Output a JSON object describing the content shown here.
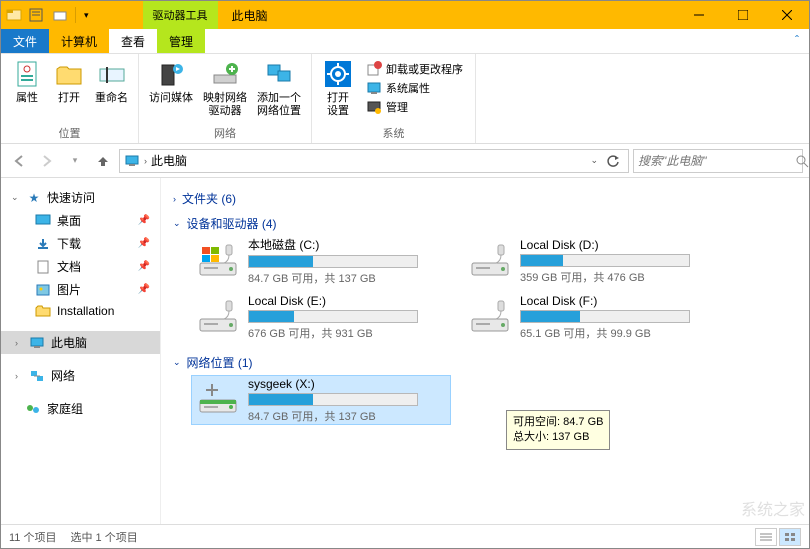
{
  "titlebar": {
    "context_tab": "驱动器工具",
    "title": "此电脑"
  },
  "ribbon_tabs": {
    "file": "文件",
    "computer": "计算机",
    "view": "查看",
    "manage": "管理"
  },
  "ribbon": {
    "group1": {
      "properties": "属性",
      "open": "打开",
      "rename": "重命名",
      "label": "位置"
    },
    "group2": {
      "access_media": "访问媒体",
      "map_drive": "映射网络\n驱动器",
      "add_location": "添加一个\n网络位置",
      "label": "网络"
    },
    "group3": {
      "open_settings": "打开\n设置",
      "uninstall": "卸载或更改程序",
      "sys_properties": "系统属性",
      "manage": "管理",
      "label": "系统"
    }
  },
  "addressbar": {
    "crumb": "此电脑",
    "search_placeholder": "搜索\"此电脑\""
  },
  "nav": {
    "quick_access": "快速访问",
    "desktop": "桌面",
    "downloads": "下载",
    "documents": "文档",
    "pictures": "图片",
    "installation": "Installation",
    "this_pc": "此电脑",
    "network": "网络",
    "homegroup": "家庭组"
  },
  "sections": {
    "folders": "文件夹 (6)",
    "drives": "设备和驱动器 (4)",
    "network": "网络位置 (1)"
  },
  "drives": [
    {
      "name": "本地磁盘 (C:)",
      "text": "84.7 GB 可用，共 137 GB",
      "fill": 38
    },
    {
      "name": "Local Disk (D:)",
      "text": "359 GB 可用，共 476 GB",
      "fill": 25
    },
    {
      "name": "Local Disk (E:)",
      "text": "676 GB 可用，共 931 GB",
      "fill": 27
    },
    {
      "name": "Local Disk (F:)",
      "text": "65.1 GB 可用，共 99.9 GB",
      "fill": 35
    }
  ],
  "network_drive": {
    "name": "sysgeek (X:)",
    "text": "84.7 GB 可用，共 137 GB",
    "fill": 38
  },
  "tooltip": {
    "line1": "可用空间: 84.7 GB",
    "line2": "总大小: 137 GB"
  },
  "statusbar": {
    "items": "11 个项目",
    "selected": "选中 1 个项目"
  },
  "watermark": "系统之家"
}
